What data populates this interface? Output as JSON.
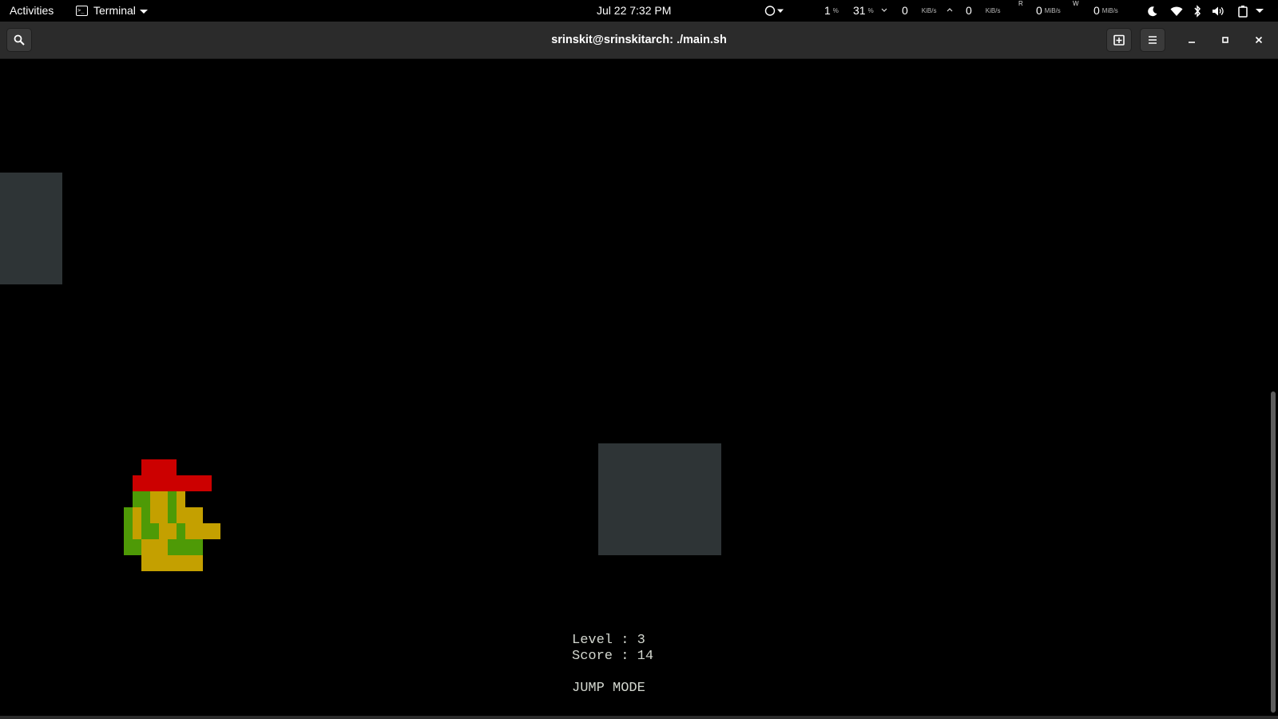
{
  "topbar": {
    "activities": "Activities",
    "app_menu": "Terminal",
    "clock": "Jul 22  7:32 PM",
    "cpu": "1",
    "cpu_unit": "%",
    "mem": "31",
    "mem_unit": "%",
    "net_down": "0",
    "net_down_unit": "KiB/s",
    "net_up": "0",
    "net_up_unit": "KiB/s",
    "disk_read_label": "R",
    "disk_read": "0",
    "disk_read_unit": "MiB/s",
    "disk_write_label": "W",
    "disk_write": "0",
    "disk_write_unit": "MiB/s",
    "icons": [
      "circle-indicator-icon",
      "night-light-icon",
      "wifi-icon",
      "bluetooth-icon",
      "volume-icon",
      "battery-icon"
    ]
  },
  "window": {
    "title": "srinskit@srinskitarch: ./main.sh",
    "icons": [
      "search-icon",
      "new-tab-icon",
      "hamburger-menu-icon",
      "minimize-icon",
      "maximize-icon",
      "close-icon"
    ]
  },
  "game": {
    "level_line": "Level : 3",
    "score_line": "Score : 14",
    "mode_line": "JUMP MODE",
    "level": 3,
    "score": 14,
    "mode": "JUMP MODE",
    "colors": {
      "background": "#000000",
      "obstacle": "#2e3436",
      "player_hat": "#cc0000",
      "player_green": "#4e9a06",
      "player_skin": "#c4a000",
      "hud_text": "#d3d7cf"
    }
  }
}
